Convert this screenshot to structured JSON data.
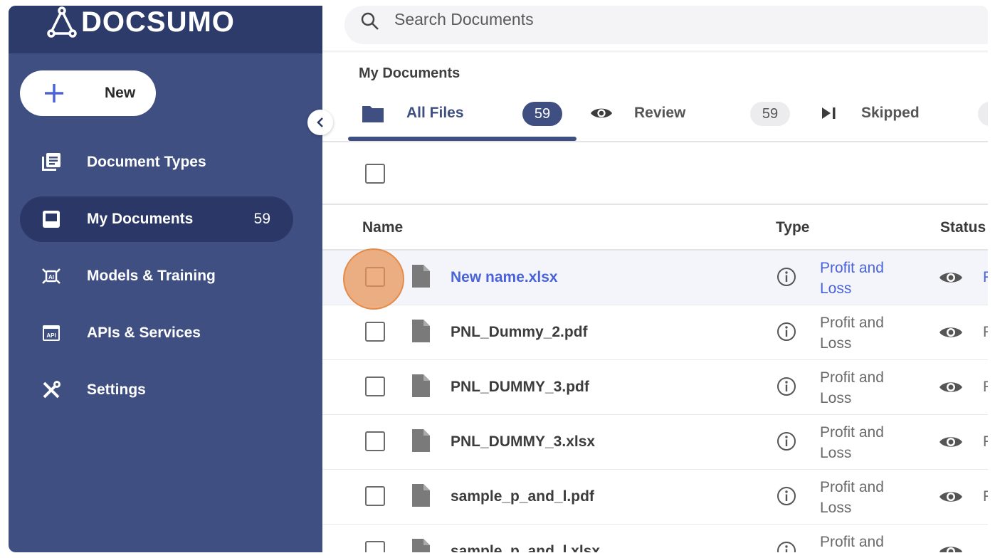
{
  "brand": {
    "name": "DOCSUMO"
  },
  "sidebar": {
    "new_button": "New",
    "items": [
      {
        "label": "Document Types",
        "icon": "document-types-icon",
        "count": ""
      },
      {
        "label": "My Documents",
        "icon": "inbox-icon",
        "count": "59",
        "active": true
      },
      {
        "label": "Models & Training",
        "icon": "ai-model-icon",
        "count": ""
      },
      {
        "label": "APIs & Services",
        "icon": "api-icon",
        "count": ""
      },
      {
        "label": "Settings",
        "icon": "tools-icon",
        "count": ""
      }
    ]
  },
  "search": {
    "placeholder": "Search Documents"
  },
  "breadcrumb": "My Documents",
  "tabs": [
    {
      "label": "All Files",
      "count": "59",
      "icon": "folder-icon",
      "active": true
    },
    {
      "label": "Review",
      "count": "59",
      "icon": "eye-icon"
    },
    {
      "label": "Skipped",
      "count": "",
      "icon": "skip-icon"
    }
  ],
  "table": {
    "columns": [
      "Name",
      "Type",
      "Status"
    ],
    "rows": [
      {
        "name": "New name.xlsx",
        "type": "Profit and Loss",
        "status": "F"
      },
      {
        "name": "PNL_Dummy_2.pdf",
        "type": "Profit and Loss",
        "status": "F"
      },
      {
        "name": "PNL_DUMMY_3.pdf",
        "type": "Profit and Loss",
        "status": "F"
      },
      {
        "name": "PNL_DUMMY_3.xlsx",
        "type": "Profit and Loss",
        "status": "F"
      },
      {
        "name": "sample_p_and_l.pdf",
        "type": "Profit and Loss",
        "status": "F"
      },
      {
        "name": "sample_p_and_l.xlsx",
        "type": "Profit and",
        "status": ""
      }
    ]
  },
  "colors": {
    "sidebar": "#3f4f82",
    "sidebar_dark": "#2d3b6b",
    "accent": "#4a63d8",
    "click_marker": "#e8965a"
  }
}
